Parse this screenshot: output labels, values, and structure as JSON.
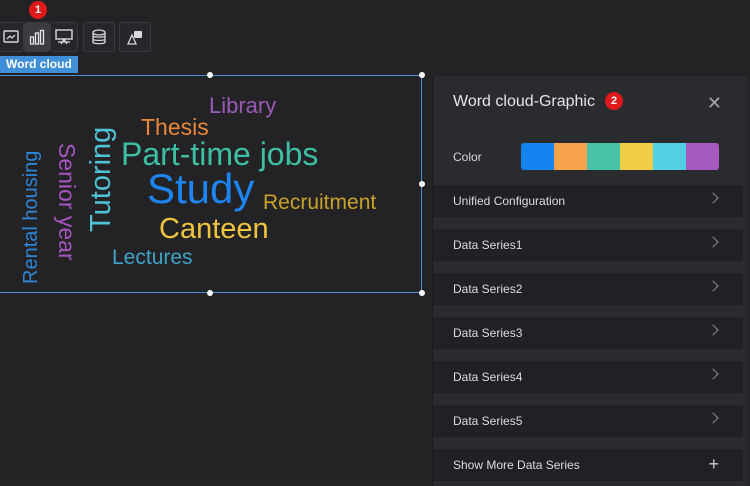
{
  "toolbar": {
    "badge": "1",
    "buttons": [
      {
        "icon": "image-chart-icon"
      },
      {
        "icon": "bar-chart-icon"
      },
      {
        "icon": "presentation-icon"
      },
      {
        "icon": "database-icon"
      },
      {
        "icon": "shapes-icon"
      }
    ]
  },
  "widget": {
    "tag": "Word cloud",
    "words": [
      {
        "text": "Library",
        "color": "#9b59b6"
      },
      {
        "text": "Thesis",
        "color": "#e8883a"
      },
      {
        "text": "Part-time jobs",
        "color": "#3dbfa6"
      },
      {
        "text": "Study",
        "color": "#1d84f2"
      },
      {
        "text": "Recruitment",
        "color": "#c9a227"
      },
      {
        "text": "Canteen",
        "color": "#efc53f"
      },
      {
        "text": "Lectures",
        "color": "#3fa3c8"
      },
      {
        "text": "Tutoring",
        "color": "#4fc3d6"
      },
      {
        "text": "Senior year",
        "color": "#a655c2"
      },
      {
        "text": "Rental housing",
        "color": "#2f86d6"
      }
    ]
  },
  "panel": {
    "title": "Word cloud-Graphic",
    "badge": "2",
    "color_label": "Color",
    "palette": [
      "#1584f0",
      "#f7a34b",
      "#46c3a8",
      "#f0cd46",
      "#52d0e4",
      "#a55ac0"
    ],
    "rows": [
      {
        "label": "Unified Configuration"
      },
      {
        "label": "Data Series1"
      },
      {
        "label": "Data Series2"
      },
      {
        "label": "Data Series3"
      },
      {
        "label": "Data Series4"
      },
      {
        "label": "Data Series5"
      },
      {
        "label": "Show More Data Series"
      }
    ]
  }
}
